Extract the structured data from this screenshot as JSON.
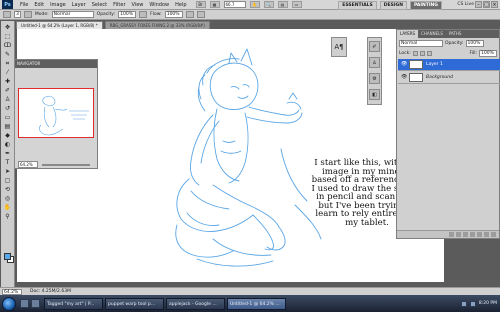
{
  "app": {
    "logo": "Ps",
    "menu": [
      "File",
      "Edit",
      "Image",
      "Layer",
      "Select",
      "Filter",
      "View",
      "Window",
      "Help"
    ],
    "zoom": "66.7",
    "workspaces": [
      "ESSENTIALS",
      "DESIGN",
      "PAINTING"
    ],
    "active_workspace": "PAINTING",
    "cs_live": "CS Live"
  },
  "options": {
    "brush_size": "3",
    "mode_label": "Mode:",
    "mode_value": "Normal",
    "opacity_label": "Opacity:",
    "opacity_value": "100%",
    "flow_label": "Flow:",
    "flow_value": "100%"
  },
  "documents": [
    {
      "title": "Untitled-1 @ 64.2% (Layer 1, RGB/8) *",
      "active": true
    },
    {
      "title": "RBG_GRASSY FOXES FIXING.2 @ 33% (RGB/8#)",
      "active": false
    }
  ],
  "navigator": {
    "title": "NAVIGATOR",
    "zoom": "64.2%"
  },
  "caption": "I start like this, with the image in my mind or based off a reference pic. I used to draw the sketch in pencil and scan it in, but I've been trying to learn to rely entirely on my tablet.",
  "layers_panel": {
    "tabs": [
      "LAYERS",
      "CHANNELS",
      "PATHS"
    ],
    "blend_mode": "Normal",
    "opacity_label": "Opacity:",
    "opacity": "100%",
    "lock_label": "Lock:",
    "fill_label": "Fill:",
    "fill": "100%",
    "layers": [
      {
        "name": "Layer 1",
        "selected": true
      },
      {
        "name": "Background",
        "selected": false
      }
    ]
  },
  "status": {
    "zoom": "64.2%",
    "doc_info": "Doc: 4.25M/2.63M"
  },
  "taskbar": {
    "items": [
      {
        "label": "Tagged \"my art\" | P...",
        "active": false
      },
      {
        "label": "puppet warp tool p...",
        "active": false
      },
      {
        "label": "applejack - Google ...",
        "active": false
      },
      {
        "label": "Untitled-1 @ 64.2% ...",
        "active": true
      }
    ],
    "time": "8:20 PM"
  },
  "colors": {
    "sketch": "#5aa6e6",
    "foreground": "#56a8ea",
    "background": "#ffffff",
    "accent": "#2f6bd6"
  }
}
